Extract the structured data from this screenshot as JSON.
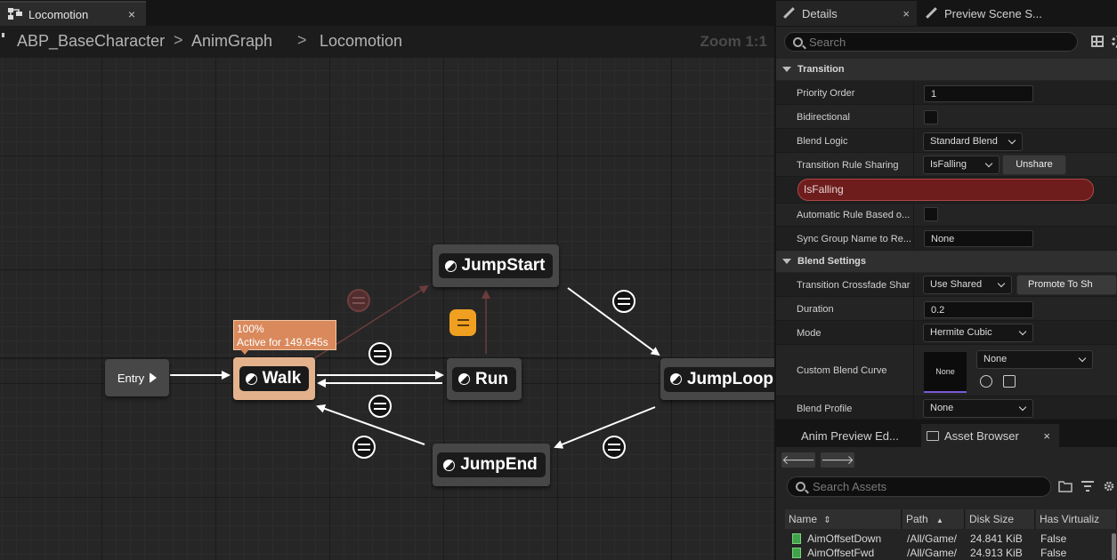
{
  "graph": {
    "tab_label": "Locomotion",
    "tab_close": "×",
    "breadcrumbs": [
      "ABP_BaseCharacter",
      "AnimGraph",
      "Locomotion"
    ],
    "breadcrumb_sep": ">",
    "zoom": "Zoom 1:1",
    "entry_label": "Entry",
    "states": {
      "walk": "Walk",
      "run": "Run",
      "jump_start": "JumpStart",
      "jump_loop": "JumpLoop",
      "jump_end": "JumpEnd"
    },
    "active_tooltip": {
      "weight": "100%",
      "active_for": "Active for 149.645s"
    }
  },
  "details": {
    "tabs": {
      "details": "Details",
      "preview": "Preview Scene S...",
      "close": "×"
    },
    "search_placeholder": "Search",
    "transition": {
      "header": "Transition",
      "priority_order_label": "Priority Order",
      "priority_order_value": "1",
      "bidirectional_label": "Bidirectional",
      "blend_logic_label": "Blend Logic",
      "blend_logic_value": "Standard Blend",
      "rule_sharing_label": "Transition Rule Sharing",
      "rule_sharing_value": "IsFalling",
      "unshare_button": "Unshare",
      "rule_name": "IsFalling",
      "automatic_rule_label": "Automatic Rule Based o...",
      "sync_group_label": "Sync Group Name to Re...",
      "sync_group_value": "None"
    },
    "blend_settings": {
      "header": "Blend Settings",
      "crossfade_label": "Transition Crossfade Shar",
      "crossfade_value": "Use Shared",
      "promote_button": "Promote To Sh",
      "duration_label": "Duration",
      "duration_value": "0.2",
      "mode_label": "Mode",
      "mode_value": "Hermite Cubic",
      "curve_label": "Custom Blend Curve",
      "curve_thumb": "None",
      "curve_value": "None",
      "profile_label": "Blend Profile",
      "profile_value": "None"
    }
  },
  "assets": {
    "tabs": {
      "anim_preview": "Anim Preview Ed...",
      "asset_browser": "Asset Browser",
      "close": "×"
    },
    "nav": {
      "back": "🡐",
      "forward": "🡒"
    },
    "search_placeholder": "Search Assets",
    "columns": {
      "name": "Name",
      "path": "Path",
      "size": "Disk Size",
      "virtualized": "Has Virtualiz"
    },
    "sort_icon": "⇕",
    "sort_icon_up": "▲",
    "rows": [
      {
        "name": "AimOffsetDown",
        "path": "/All/Game/",
        "size": "24.841 KiB",
        "virtualized": "False"
      },
      {
        "name": "AimOffsetFwd",
        "path": "/All/Game/",
        "size": "24.913 KiB",
        "virtualized": "False"
      }
    ]
  }
}
